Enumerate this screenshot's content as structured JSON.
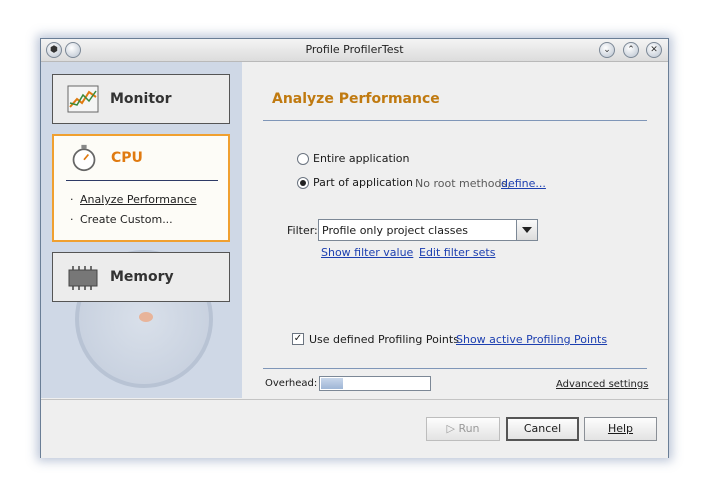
{
  "window": {
    "title": "Profile ProfilerTest"
  },
  "left": {
    "monitor_label": "Monitor",
    "cpu_label": "CPU",
    "cpu_items": [
      "Analyze Performance",
      "Create Custom..."
    ],
    "memory_label": "Memory"
  },
  "main": {
    "heading": "Analyze Performance",
    "entire_label": "Entire application",
    "part_label": "Part of application",
    "no_root_text": "No root methods,",
    "define_link": "define...",
    "filter_label": "Filter:",
    "filter_value": "Profile only project classes",
    "show_filter_link": "Show filter value",
    "edit_filter_link": "Edit filter sets",
    "profiling_points_label": "Use defined Profiling Points",
    "profiling_points_checked": true,
    "show_points_link": "Show active Profiling Points",
    "overhead_label": "Overhead:",
    "overhead_fraction": 0.2,
    "advanced_link": "Advanced settings"
  },
  "footer": {
    "run": "Run",
    "cancel": "Cancel",
    "help": "Help"
  },
  "colors": {
    "accent": "#e07a10",
    "link": "#1c3fb0",
    "selected_border": "#f0a030"
  },
  "icons": [
    "app-icon",
    "minimize-icon",
    "chevron-down-icon",
    "chevron-up-icon",
    "close-icon",
    "monitor-chart-icon",
    "stopwatch-icon",
    "memory-chip-icon",
    "run-icon",
    "dropdown-arrow-icon"
  ]
}
